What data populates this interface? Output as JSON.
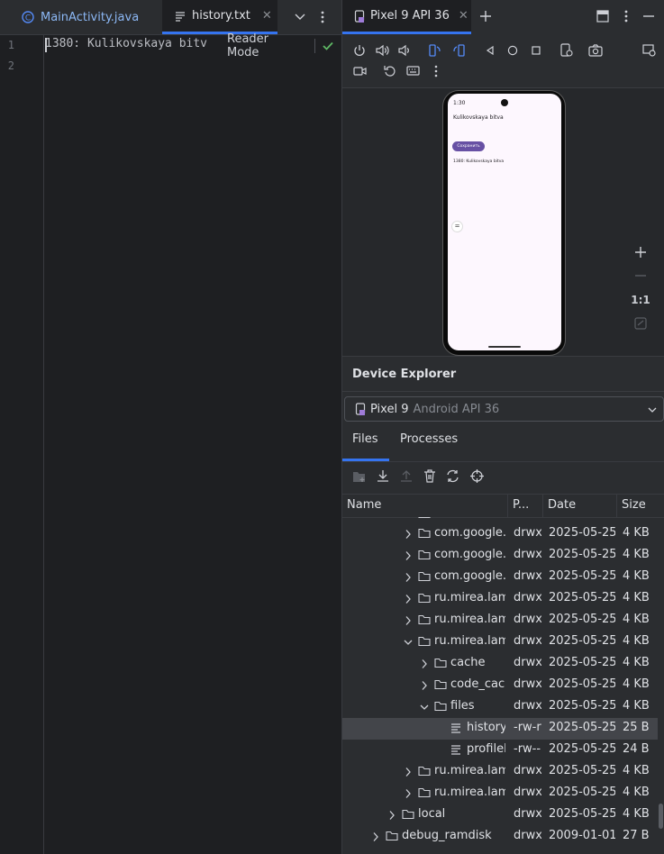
{
  "editor": {
    "tabs": [
      {
        "label": "MainActivity.java",
        "active": false
      },
      {
        "label": "history.txt",
        "active": true
      }
    ],
    "line_numbers": [
      "1",
      "2"
    ],
    "line1": "1380: Kulikovskaya bitv",
    "reader_mode": "Reader Mode"
  },
  "right": {
    "device_tab": "Pixel 9 API 36",
    "zoom_label": "1:1",
    "phone_screen": {
      "clock": "1:30",
      "title_text": "Kulikovskaya bitva",
      "button": "Сохранить",
      "body_text": "1380: Kulikovskaya bitva"
    }
  },
  "device_explorer": {
    "title": "Device Explorer",
    "device_name": "Pixel 9",
    "device_detail": "Android API 36",
    "tabs": [
      "Files",
      "Processes"
    ],
    "columns": [
      "Name",
      "P...",
      "Date",
      "Size"
    ],
    "rows": [
      {
        "name": "com.google.a",
        "perm": "drwx",
        "date": "2025-05-25",
        "size": "4 KB",
        "depth": 4,
        "expanded": false
      },
      {
        "name": "com.google.n",
        "perm": "drwx",
        "date": "2025-05-25",
        "size": "4 KB",
        "depth": 4,
        "expanded": false
      },
      {
        "name": "com.google.n",
        "perm": "drwx",
        "date": "2025-05-25",
        "size": "4 KB",
        "depth": 4,
        "expanded": false
      },
      {
        "name": "ru.mirea.lamz",
        "perm": "drwx",
        "date": "2025-05-25",
        "size": "4 KB",
        "depth": 4,
        "expanded": false
      },
      {
        "name": "ru.mirea.lamz",
        "perm": "drwx",
        "date": "2025-05-25",
        "size": "4 KB",
        "depth": 4,
        "expanded": false
      },
      {
        "name": "ru.mirea.lamz",
        "perm": "drwx",
        "date": "2025-05-25",
        "size": "4 KB",
        "depth": 4,
        "expanded": true
      },
      {
        "name": "cache",
        "perm": "drwx",
        "date": "2025-05-25",
        "size": "4 KB",
        "depth": 5,
        "expanded": false
      },
      {
        "name": "code_cach",
        "perm": "drwx",
        "date": "2025-05-25",
        "size": "4 KB",
        "depth": 5,
        "expanded": false
      },
      {
        "name": "files",
        "perm": "drwx",
        "date": "2025-05-25",
        "size": "4 KB",
        "depth": 5,
        "expanded": true
      },
      {
        "name": "history.",
        "perm": "-rw-r",
        "date": "2025-05-25",
        "size": "25 B",
        "depth": 6,
        "file": true,
        "selected": true
      },
      {
        "name": "profilel",
        "perm": "-rw--",
        "date": "2025-05-25",
        "size": "24 B",
        "depth": 6,
        "file": true
      },
      {
        "name": "ru.mirea.lamz",
        "perm": "drwx",
        "date": "2025-05-25",
        "size": "4 KB",
        "depth": 4,
        "expanded": false
      },
      {
        "name": "ru.mirea.lamz",
        "perm": "drwx",
        "date": "2025-05-25",
        "size": "4 KB",
        "depth": 4,
        "expanded": false
      },
      {
        "name": "local",
        "perm": "drwx",
        "date": "2025-05-25",
        "size": "4 KB",
        "depth": 3,
        "expanded": false
      },
      {
        "name": "debug_ramdisk",
        "perm": "drwx",
        "date": "2009-01-01",
        "size": "27 B",
        "depth": 2,
        "expanded": false
      }
    ]
  },
  "colors": {
    "accent": "#3574f0",
    "selected_row": "#43454a",
    "folder": "#ced0d6",
    "phone_button": "#6750a4",
    "check": "#5fb865"
  }
}
